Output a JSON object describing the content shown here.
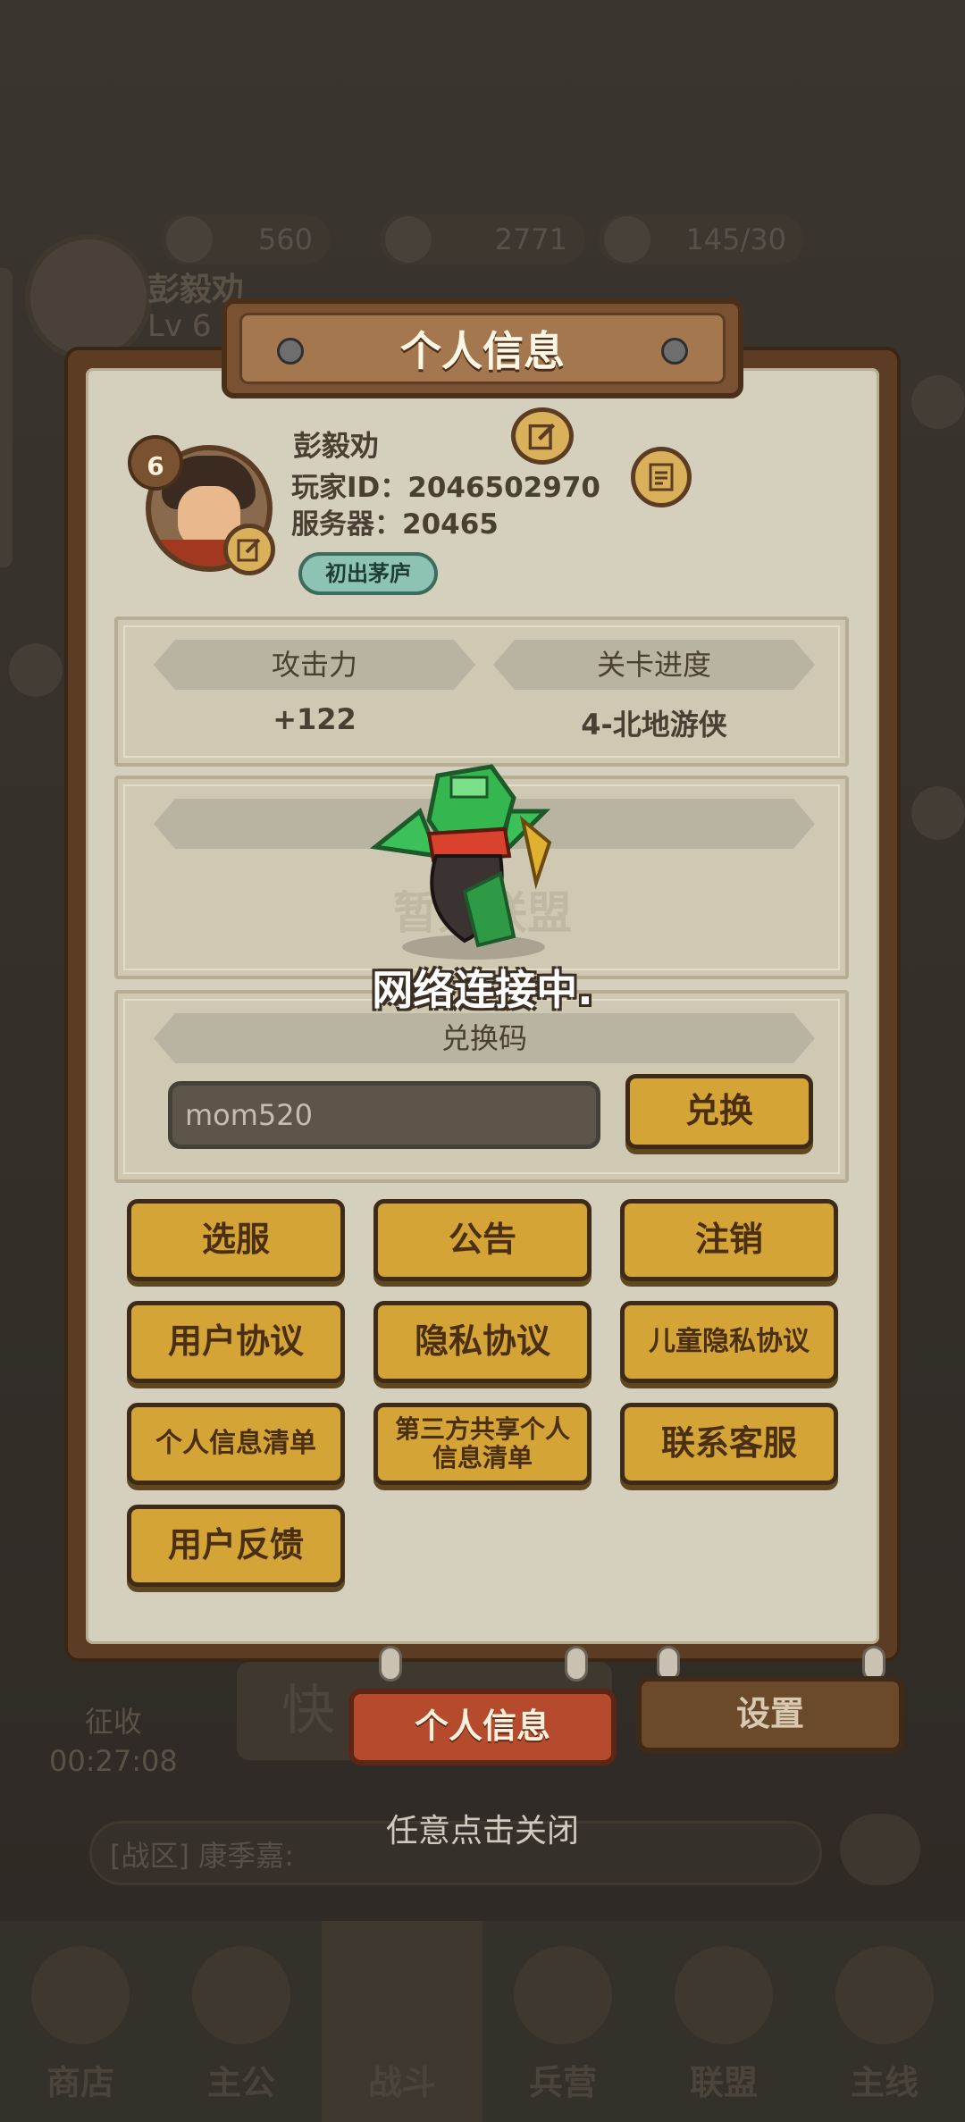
{
  "background": {
    "player_name": "彭毅劝",
    "level": "Lv 6",
    "resources": [
      "560",
      "2771",
      "145/30"
    ],
    "timer_label": "征收",
    "timer_value": "00:27:08",
    "quick_label": "快",
    "chat_text": "[战区] 康季嘉:",
    "tabs": [
      "商店",
      "主公",
      "战斗",
      "兵营",
      "联盟",
      "主线"
    ]
  },
  "modal": {
    "title": "个人信息",
    "profile": {
      "level": "6",
      "name": "彭毅劝",
      "player_id": "玩家ID：2046502970",
      "server": "服务器：20465",
      "title_badge": "初出茅庐"
    },
    "stats": {
      "attack_label": "攻击力",
      "attack_value": "+122",
      "progress_label": "关卡进度",
      "progress_value": "4-北地游侠"
    },
    "alliance": {
      "value_partial": "暂无联盟"
    },
    "redeem": {
      "label": "兑换码",
      "input_value": "mom520",
      "button": "兑换"
    },
    "buttons": {
      "select_server": "选服",
      "announcement": "公告",
      "logout": "注销",
      "user_agreement": "用户协议",
      "privacy_agreement": "隐私协议",
      "child_privacy": "儿童隐私协议",
      "personal_info_list": "个人信息清单",
      "third_party_info": "第三方共享个人信息清单",
      "customer_service": "联系客服",
      "feedback": "用户反馈"
    },
    "tabs": {
      "personal_info": "个人信息",
      "settings": "设置"
    },
    "close_hint": "任意点击关闭"
  },
  "loading": {
    "text": "网络连接中."
  },
  "colors": {
    "panel_frame": "#5c3d24",
    "panel_paper": "#d5d0bd",
    "button_gold": "#d4a536",
    "tab_active": "#b54a2c",
    "hat_green": "#2fb34a"
  }
}
